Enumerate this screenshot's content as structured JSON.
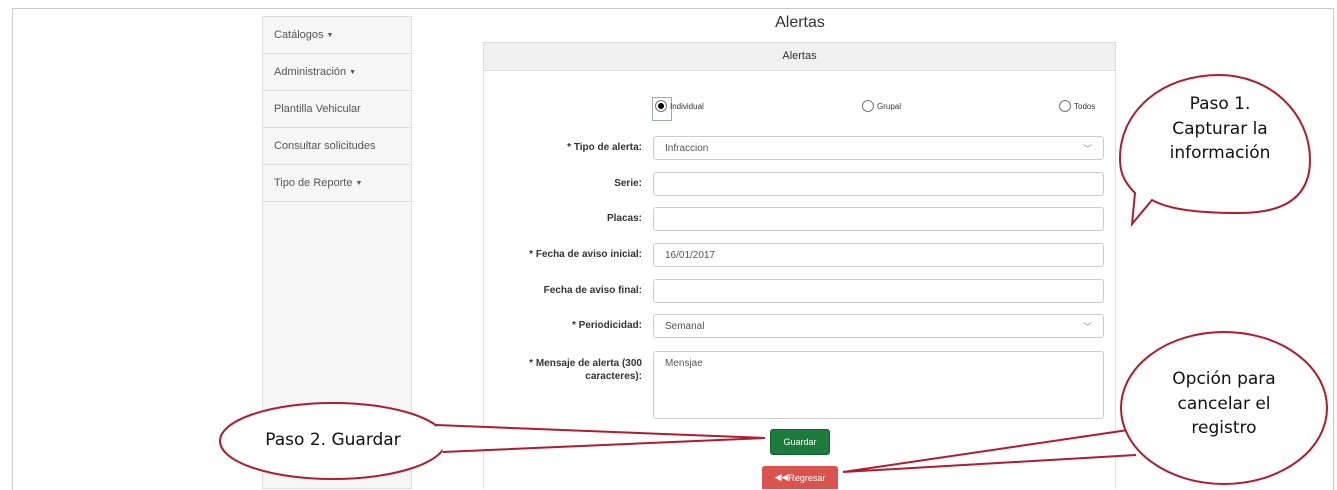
{
  "sidebar": {
    "items": [
      {
        "label": "Catálogos",
        "caret": true
      },
      {
        "label": "Administración",
        "caret": true
      },
      {
        "label": "Plantilla Vehicular",
        "caret": false
      },
      {
        "label": "Consultar solicitudes",
        "caret": false
      },
      {
        "label": "Tipo de Reporte",
        "caret": true
      }
    ]
  },
  "page": {
    "title": "Alertas"
  },
  "panel": {
    "heading": "Alertas",
    "radios": [
      {
        "label": "Individual",
        "selected": true
      },
      {
        "label": "Grupal",
        "selected": false
      },
      {
        "label": "Todos",
        "selected": false
      }
    ],
    "fields": {
      "tipo_alerta": {
        "label": "* Tipo de alerta:",
        "value": "Infraccion"
      },
      "serie": {
        "label": "Serie:",
        "value": ""
      },
      "placas": {
        "label": "Placas:",
        "value": ""
      },
      "fecha_inicial": {
        "label": "* Fecha de aviso inicial:",
        "value": "16/01/2017"
      },
      "fecha_final": {
        "label": "Fecha de aviso final:",
        "value": ""
      },
      "periodicidad": {
        "label": "* Periodicidad:",
        "value": "Semanal"
      },
      "mensaje": {
        "label_line1": "* Mensaje de alerta (300",
        "label_line2": "caracteres):",
        "value": "Mensjae"
      }
    },
    "buttons": {
      "save": "Guardar",
      "back": "Regresar"
    }
  },
  "callouts": {
    "paso1": {
      "line1": "Paso 1.",
      "line2": "Capturar la",
      "line3": "información"
    },
    "paso2": {
      "text": "Paso 2. Guardar"
    },
    "cancel": {
      "line1": "Opción para",
      "line2": "cancelar el",
      "line3": "registro"
    }
  },
  "colors": {
    "save_button": "#1e7b3e",
    "back_button": "#d9534f",
    "callout_border": "#b01c2e"
  }
}
